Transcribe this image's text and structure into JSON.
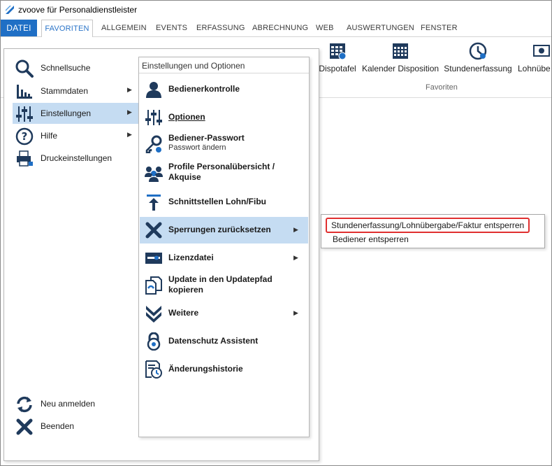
{
  "window": {
    "title": "zvoove für Personaldienstleister"
  },
  "menubar": {
    "tabs": [
      "DATEI",
      "FAVORITEN",
      "ALLGEMEIN",
      "EVENTS",
      "ERFASSUNG",
      "ABRECHNUNG",
      "WEB",
      "AUSWERTUNGEN",
      "FENSTER"
    ]
  },
  "ribbon": {
    "items": [
      "Dispotafel",
      "Kalender Disposition",
      "Stundenerfassung",
      "Lohnübe"
    ],
    "group_label": "Favoriten"
  },
  "left_menu": {
    "items": [
      {
        "label": "Schnellsuche",
        "icon": "search-icon",
        "has_arrow": false
      },
      {
        "label": "Stammdaten",
        "icon": "bar-chart-icon",
        "has_arrow": true
      },
      {
        "label": "Einstellungen",
        "icon": "sliders-icon",
        "has_arrow": true,
        "active": true
      },
      {
        "label": "Hilfe",
        "icon": "help-icon",
        "has_arrow": true
      },
      {
        "label": "Druckeinstellungen",
        "icon": "printer-icon",
        "has_arrow": false
      }
    ],
    "bottom_items": [
      {
        "label": "Neu anmelden",
        "icon": "refresh-icon"
      },
      {
        "label": "Beenden",
        "icon": "close-icon"
      }
    ]
  },
  "submenu": {
    "header": "Einstellungen und Optionen",
    "items": [
      {
        "label": "Bedienerkontrolle",
        "icon": "user-icon"
      },
      {
        "label": "Optionen",
        "icon": "sliders-icon"
      },
      {
        "label": "Bediener-Passwort",
        "sublabel": "Passwort ändern",
        "icon": "key-icon"
      },
      {
        "label": "Profile Personalübersicht / Akquise",
        "icon": "group-icon"
      },
      {
        "label": "Schnittstellen Lohn/Fibu",
        "icon": "upload-arrow-icon"
      },
      {
        "label": "Sperrungen zurücksetzen",
        "icon": "x-mark-icon",
        "has_arrow": true,
        "active": true
      },
      {
        "label": "Lizenzdatei",
        "icon": "license-card-icon",
        "has_arrow": true
      },
      {
        "label": "Update in den Updatepfad kopieren",
        "icon": "file-copy-icon"
      },
      {
        "label": "Weitere",
        "icon": "double-chevron-down-icon",
        "has_arrow": true
      },
      {
        "label": "Datenschutz Assistent",
        "icon": "padlock-icon"
      },
      {
        "label": "Änderungshistorie",
        "icon": "history-document-icon"
      }
    ]
  },
  "popup": {
    "items": [
      {
        "label": "Stundenerfassung/Lohnübergabe/Faktur entsperren",
        "highlighted": true
      },
      {
        "label": "Bediener entsperren"
      }
    ]
  },
  "colors": {
    "accent": "#1f6fc5",
    "highlight": "#c5dcf2",
    "icon": "#1f3a5c",
    "callout": "#e03030"
  }
}
